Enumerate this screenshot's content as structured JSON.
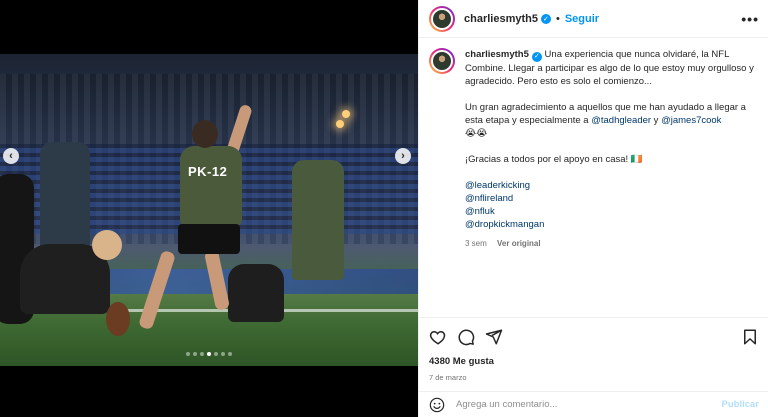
{
  "post": {
    "username": "charliesmyth5",
    "separator": "•",
    "follow_label": "Seguir",
    "more_icon": "more-horizontal-icon"
  },
  "caption": {
    "username": "charliesmyth5",
    "text1": "Una experiencia que nunca olvidaré, la NFL Combine. Llegar a participar es algo de lo que estoy muy orgulloso y agradecido. Pero esto es solo el comienzo...",
    "text2_before": "Un gran agradecimiento a aquellos que me han ayudado a llegar a esta etapa y especialmente a ",
    "mention1": "@tadhgleader",
    "text2_mid": " y ",
    "mention2": "@james7cook",
    "emoji_line": "😭😭",
    "text3": "¡Gracias a todos por el apoyo en casa! 🇮🇪",
    "tags": [
      "@leaderkicking",
      "@nflireland",
      "@nfluk",
      "@dropkickmangan"
    ],
    "time_ago": "3 sem",
    "see_translation": "Ver original"
  },
  "media": {
    "jersey_text": "PK-12",
    "carousel_dots": 7,
    "active_dot": 3
  },
  "actions": {
    "likes": "4380 Me gusta",
    "date": "7 de marzo"
  },
  "comment": {
    "placeholder": "Agrega un comentario...",
    "publish_label": "Publicar"
  },
  "colors": {
    "accent": "#0095f6",
    "mention": "#00376b",
    "muted": "#737373"
  }
}
